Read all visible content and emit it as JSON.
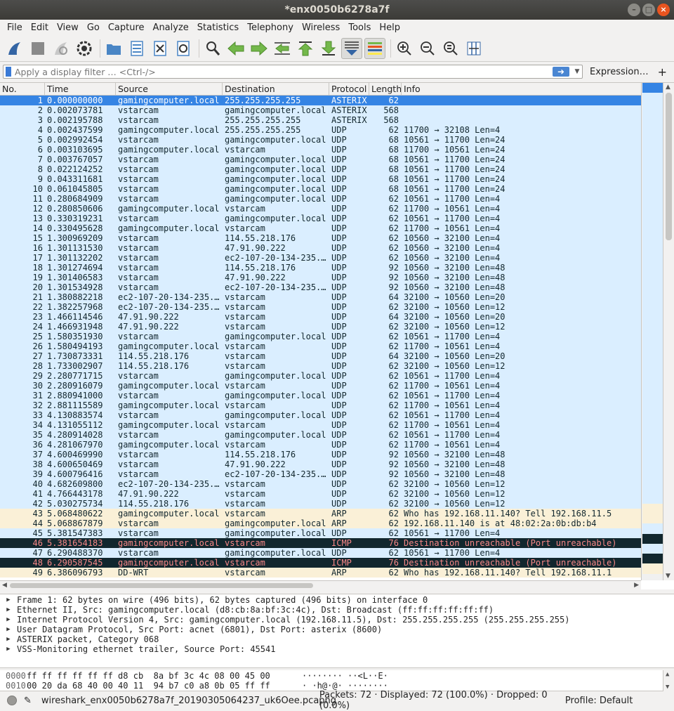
{
  "window": {
    "title": "*enx0050b6278a7f"
  },
  "menu": [
    "File",
    "Edit",
    "View",
    "Go",
    "Capture",
    "Analyze",
    "Statistics",
    "Telephony",
    "Wireless",
    "Tools",
    "Help"
  ],
  "filter": {
    "placeholder": "Apply a display filter … <Ctrl-/>",
    "expression_label": "Expression…",
    "plus_label": "+"
  },
  "columns": [
    "No.",
    "Time",
    "Source",
    "Destination",
    "Protocol",
    "Length",
    "Info"
  ],
  "packets": [
    {
      "no": "1",
      "time": "0.000000000",
      "src": "gamingcomputer.local",
      "dst": "255.255.255.255",
      "proto": "ASTERIX",
      "len": "62",
      "info": "",
      "kind": "selected"
    },
    {
      "no": "2",
      "time": "0.002073781",
      "src": "vstarcam",
      "dst": "gamingcomputer.local",
      "proto": "ASTERIX",
      "len": "568",
      "info": "",
      "kind": "udp"
    },
    {
      "no": "3",
      "time": "0.002195788",
      "src": "vstarcam",
      "dst": "255.255.255.255",
      "proto": "ASTERIX",
      "len": "568",
      "info": "",
      "kind": "udp"
    },
    {
      "no": "4",
      "time": "0.002437599",
      "src": "gamingcomputer.local",
      "dst": "255.255.255.255",
      "proto": "UDP",
      "len": "62",
      "info": "11700 → 32108 Len=4",
      "kind": "udp"
    },
    {
      "no": "5",
      "time": "0.002992454",
      "src": "vstarcam",
      "dst": "gamingcomputer.local",
      "proto": "UDP",
      "len": "68",
      "info": "10561 → 11700 Len=24",
      "kind": "udp"
    },
    {
      "no": "6",
      "time": "0.003103695",
      "src": "gamingcomputer.local",
      "dst": "vstarcam",
      "proto": "UDP",
      "len": "68",
      "info": "11700 → 10561 Len=24",
      "kind": "udp"
    },
    {
      "no": "7",
      "time": "0.003767057",
      "src": "vstarcam",
      "dst": "gamingcomputer.local",
      "proto": "UDP",
      "len": "68",
      "info": "10561 → 11700 Len=24",
      "kind": "udp"
    },
    {
      "no": "8",
      "time": "0.022124252",
      "src": "vstarcam",
      "dst": "gamingcomputer.local",
      "proto": "UDP",
      "len": "68",
      "info": "10561 → 11700 Len=24",
      "kind": "udp"
    },
    {
      "no": "9",
      "time": "0.043311681",
      "src": "vstarcam",
      "dst": "gamingcomputer.local",
      "proto": "UDP",
      "len": "68",
      "info": "10561 → 11700 Len=24",
      "kind": "udp"
    },
    {
      "no": "10",
      "time": "0.061045805",
      "src": "vstarcam",
      "dst": "gamingcomputer.local",
      "proto": "UDP",
      "len": "68",
      "info": "10561 → 11700 Len=24",
      "kind": "udp"
    },
    {
      "no": "11",
      "time": "0.280684909",
      "src": "vstarcam",
      "dst": "gamingcomputer.local",
      "proto": "UDP",
      "len": "62",
      "info": "10561 → 11700 Len=4",
      "kind": "udp"
    },
    {
      "no": "12",
      "time": "0.280850606",
      "src": "gamingcomputer.local",
      "dst": "vstarcam",
      "proto": "UDP",
      "len": "62",
      "info": "11700 → 10561 Len=4",
      "kind": "udp"
    },
    {
      "no": "13",
      "time": "0.330319231",
      "src": "vstarcam",
      "dst": "gamingcomputer.local",
      "proto": "UDP",
      "len": "62",
      "info": "10561 → 11700 Len=4",
      "kind": "udp"
    },
    {
      "no": "14",
      "time": "0.330495628",
      "src": "gamingcomputer.local",
      "dst": "vstarcam",
      "proto": "UDP",
      "len": "62",
      "info": "11700 → 10561 Len=4",
      "kind": "udp"
    },
    {
      "no": "15",
      "time": "1.300969209",
      "src": "vstarcam",
      "dst": "114.55.218.176",
      "proto": "UDP",
      "len": "62",
      "info": "10560 → 32100 Len=4",
      "kind": "udp"
    },
    {
      "no": "16",
      "time": "1.301131530",
      "src": "vstarcam",
      "dst": "47.91.90.222",
      "proto": "UDP",
      "len": "62",
      "info": "10560 → 32100 Len=4",
      "kind": "udp"
    },
    {
      "no": "17",
      "time": "1.301132202",
      "src": "vstarcam",
      "dst": "ec2-107-20-134-235.…",
      "proto": "UDP",
      "len": "62",
      "info": "10560 → 32100 Len=4",
      "kind": "udp"
    },
    {
      "no": "18",
      "time": "1.301274694",
      "src": "vstarcam",
      "dst": "114.55.218.176",
      "proto": "UDP",
      "len": "92",
      "info": "10560 → 32100 Len=48",
      "kind": "udp"
    },
    {
      "no": "19",
      "time": "1.301406583",
      "src": "vstarcam",
      "dst": "47.91.90.222",
      "proto": "UDP",
      "len": "92",
      "info": "10560 → 32100 Len=48",
      "kind": "udp"
    },
    {
      "no": "20",
      "time": "1.301534928",
      "src": "vstarcam",
      "dst": "ec2-107-20-134-235.…",
      "proto": "UDP",
      "len": "92",
      "info": "10560 → 32100 Len=48",
      "kind": "udp"
    },
    {
      "no": "21",
      "time": "1.380882218",
      "src": "ec2-107-20-134-235.…",
      "dst": "vstarcam",
      "proto": "UDP",
      "len": "64",
      "info": "32100 → 10560 Len=20",
      "kind": "udp"
    },
    {
      "no": "22",
      "time": "1.382257968",
      "src": "ec2-107-20-134-235.…",
      "dst": "vstarcam",
      "proto": "UDP",
      "len": "62",
      "info": "32100 → 10560 Len=12",
      "kind": "udp"
    },
    {
      "no": "23",
      "time": "1.466114546",
      "src": "47.91.90.222",
      "dst": "vstarcam",
      "proto": "UDP",
      "len": "64",
      "info": "32100 → 10560 Len=20",
      "kind": "udp"
    },
    {
      "no": "24",
      "time": "1.466931948",
      "src": "47.91.90.222",
      "dst": "vstarcam",
      "proto": "UDP",
      "len": "62",
      "info": "32100 → 10560 Len=12",
      "kind": "udp"
    },
    {
      "no": "25",
      "time": "1.580351930",
      "src": "vstarcam",
      "dst": "gamingcomputer.local",
      "proto": "UDP",
      "len": "62",
      "info": "10561 → 11700 Len=4",
      "kind": "udp"
    },
    {
      "no": "26",
      "time": "1.580494193",
      "src": "gamingcomputer.local",
      "dst": "vstarcam",
      "proto": "UDP",
      "len": "62",
      "info": "11700 → 10561 Len=4",
      "kind": "udp"
    },
    {
      "no": "27",
      "time": "1.730873331",
      "src": "114.55.218.176",
      "dst": "vstarcam",
      "proto": "UDP",
      "len": "64",
      "info": "32100 → 10560 Len=20",
      "kind": "udp"
    },
    {
      "no": "28",
      "time": "1.733002907",
      "src": "114.55.218.176",
      "dst": "vstarcam",
      "proto": "UDP",
      "len": "62",
      "info": "32100 → 10560 Len=12",
      "kind": "udp"
    },
    {
      "no": "29",
      "time": "2.280771715",
      "src": "vstarcam",
      "dst": "gamingcomputer.local",
      "proto": "UDP",
      "len": "62",
      "info": "10561 → 11700 Len=4",
      "kind": "udp"
    },
    {
      "no": "30",
      "time": "2.280916079",
      "src": "gamingcomputer.local",
      "dst": "vstarcam",
      "proto": "UDP",
      "len": "62",
      "info": "11700 → 10561 Len=4",
      "kind": "udp"
    },
    {
      "no": "31",
      "time": "2.880941000",
      "src": "vstarcam",
      "dst": "gamingcomputer.local",
      "proto": "UDP",
      "len": "62",
      "info": "10561 → 11700 Len=4",
      "kind": "udp"
    },
    {
      "no": "32",
      "time": "2.881115589",
      "src": "gamingcomputer.local",
      "dst": "vstarcam",
      "proto": "UDP",
      "len": "62",
      "info": "11700 → 10561 Len=4",
      "kind": "udp"
    },
    {
      "no": "33",
      "time": "4.130883574",
      "src": "vstarcam",
      "dst": "gamingcomputer.local",
      "proto": "UDP",
      "len": "62",
      "info": "10561 → 11700 Len=4",
      "kind": "udp"
    },
    {
      "no": "34",
      "time": "4.131055112",
      "src": "gamingcomputer.local",
      "dst": "vstarcam",
      "proto": "UDP",
      "len": "62",
      "info": "11700 → 10561 Len=4",
      "kind": "udp"
    },
    {
      "no": "35",
      "time": "4.280914028",
      "src": "vstarcam",
      "dst": "gamingcomputer.local",
      "proto": "UDP",
      "len": "62",
      "info": "10561 → 11700 Len=4",
      "kind": "udp"
    },
    {
      "no": "36",
      "time": "4.281067970",
      "src": "gamingcomputer.local",
      "dst": "vstarcam",
      "proto": "UDP",
      "len": "62",
      "info": "11700 → 10561 Len=4",
      "kind": "udp"
    },
    {
      "no": "37",
      "time": "4.600469990",
      "src": "vstarcam",
      "dst": "114.55.218.176",
      "proto": "UDP",
      "len": "92",
      "info": "10560 → 32100 Len=48",
      "kind": "udp"
    },
    {
      "no": "38",
      "time": "4.600650469",
      "src": "vstarcam",
      "dst": "47.91.90.222",
      "proto": "UDP",
      "len": "92",
      "info": "10560 → 32100 Len=48",
      "kind": "udp"
    },
    {
      "no": "39",
      "time": "4.600796416",
      "src": "vstarcam",
      "dst": "ec2-107-20-134-235.…",
      "proto": "UDP",
      "len": "92",
      "info": "10560 → 32100 Len=48",
      "kind": "udp"
    },
    {
      "no": "40",
      "time": "4.682609800",
      "src": "ec2-107-20-134-235.…",
      "dst": "vstarcam",
      "proto": "UDP",
      "len": "62",
      "info": "32100 → 10560 Len=12",
      "kind": "udp"
    },
    {
      "no": "41",
      "time": "4.766443178",
      "src": "47.91.90.222",
      "dst": "vstarcam",
      "proto": "UDP",
      "len": "62",
      "info": "32100 → 10560 Len=12",
      "kind": "udp"
    },
    {
      "no": "42",
      "time": "5.030275734",
      "src": "114.55.218.176",
      "dst": "vstarcam",
      "proto": "UDP",
      "len": "62",
      "info": "32100 → 10560 Len=12",
      "kind": "udp"
    },
    {
      "no": "43",
      "time": "5.068480622",
      "src": "gamingcomputer.local",
      "dst": "vstarcam",
      "proto": "ARP",
      "len": "62",
      "info": "Who has 192.168.11.140? Tell 192.168.11.5",
      "kind": "arp"
    },
    {
      "no": "44",
      "time": "5.068867879",
      "src": "vstarcam",
      "dst": "gamingcomputer.local",
      "proto": "ARP",
      "len": "62",
      "info": "192.168.11.140 is at 48:02:2a:0b:db:b4",
      "kind": "arp"
    },
    {
      "no": "45",
      "time": "5.381547383",
      "src": "vstarcam",
      "dst": "gamingcomputer.local",
      "proto": "UDP",
      "len": "62",
      "info": "10561 → 11700 Len=4",
      "kind": "udp"
    },
    {
      "no": "46",
      "time": "5.381654183",
      "src": "gamingcomputer.local",
      "dst": "vstarcam",
      "proto": "ICMP",
      "len": "76",
      "info": "Destination unreachable (Port unreachable)",
      "kind": "icmp"
    },
    {
      "no": "47",
      "time": "6.290488370",
      "src": "vstarcam",
      "dst": "gamingcomputer.local",
      "proto": "UDP",
      "len": "62",
      "info": "10561 → 11700 Len=4",
      "kind": "udp"
    },
    {
      "no": "48",
      "time": "6.290587545",
      "src": "gamingcomputer.local",
      "dst": "vstarcam",
      "proto": "ICMP",
      "len": "76",
      "info": "Destination unreachable (Port unreachable)",
      "kind": "icmp"
    },
    {
      "no": "49",
      "time": "6.386096793",
      "src": "DD-WRT",
      "dst": "vstarcam",
      "proto": "ARP",
      "len": "62",
      "info": "Who has 192.168.11.140? Tell 192.168.11.1",
      "kind": "arp"
    }
  ],
  "details": [
    "Frame 1: 62 bytes on wire (496 bits), 62 bytes captured (496 bits) on interface 0",
    "Ethernet II, Src: gamingcomputer.local (d8:cb:8a:bf:3c:4c), Dst: Broadcast (ff:ff:ff:ff:ff:ff)",
    "Internet Protocol Version 4, Src: gamingcomputer.local (192.168.11.5), Dst: 255.255.255.255 (255.255.255.255)",
    "User Datagram Protocol, Src Port: acnet (6801), Dst Port: asterix (8600)",
    "ASTERIX packet, Category 068",
    "VSS-Monitoring ethernet trailer, Source Port: 45541"
  ],
  "bytes": [
    {
      "offset": "0000",
      "hex": "ff ff ff ff ff ff d8 cb  8a bf 3c 4c 08 00 45 00",
      "ascii": "········ ··<L··E·"
    },
    {
      "offset": "0010",
      "hex": "00 20 da 68 40 00 40 11  94 b7 c0 a8 0b 05 ff ff",
      "ascii": "· ·h@·@· ········"
    }
  ],
  "status": {
    "file": "wireshark_enx0050b6278a7f_20190305064237_uk6Oee.pcapng",
    "packets": "Packets: 72 · Displayed: 72 (100.0%) · Dropped: 0 (0.0%)",
    "profile": "Profile: Default"
  },
  "colors": {
    "udp": "#daeeff",
    "arp": "#faf0d7",
    "icmp_bg": "#12272e",
    "icmp_fg": "#f78787",
    "selected": "#3584e4"
  }
}
